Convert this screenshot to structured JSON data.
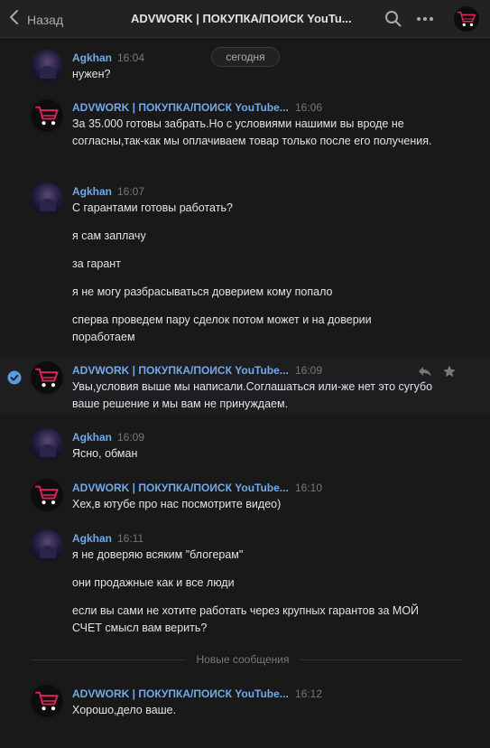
{
  "header": {
    "back_label": "Назад",
    "title": "ADVWORK | ПОКУПКА/ПОИСК YouTu..."
  },
  "date_label": "сегодня",
  "new_messages_label": "Новые сообщения",
  "messages": [
    {
      "author": "Agkhan",
      "time": "16:04",
      "lines": [
        "нужен?"
      ]
    },
    {
      "author": "ADVWORK | ПОКУПКА/ПОИСК YouTube...",
      "time": "16:06",
      "lines": [
        "За 35.000 готовы забрать.Но с условиями нашими вы вроде не согласны,так-как мы оплачиваем товар только после его получения."
      ]
    },
    {
      "author": "Agkhan",
      "time": "16:07",
      "lines": [
        "С гарантами готовы работать?",
        "я сам заплачу",
        "за гарант",
        "я не могу разбрасываться доверием кому попало",
        "сперва проведем пару сделок потом может и на доверии поработаем"
      ]
    },
    {
      "author": "ADVWORK | ПОКУПКА/ПОИСК YouTube...",
      "time": "16:09",
      "lines": [
        "Увы,условия выше мы написали.Соглашаться или-же нет это сугубо ваше решение и мы вам не принуждаем."
      ]
    },
    {
      "author": "Agkhan",
      "time": "16:09",
      "lines": [
        "Ясно, обман"
      ]
    },
    {
      "author": "ADVWORK | ПОКУПКА/ПОИСК YouTube...",
      "time": "16:10",
      "lines": [
        "Хех,в ютубе про нас посмотрите видео)"
      ]
    },
    {
      "author": "Agkhan",
      "time": "16:11",
      "lines": [
        "я не доверяю всяким \"блогерам\"",
        "они продажные как и все люди",
        "если вы сами не хотите работать через крупных гарантов за МОЙ СЧЕТ смысл вам верить?"
      ]
    },
    {
      "author": "ADVWORK | ПОКУПКА/ПОИСК YouTube...",
      "time": "16:12",
      "lines": [
        "Хорошо,дело ваше."
      ]
    }
  ],
  "icons": {
    "back": "chevron-left-icon",
    "search": "search-icon",
    "more": "more-icon",
    "reply": "reply-icon",
    "favorite": "star-icon",
    "read": "check-circle-icon",
    "cart": "shopping-cart-icon"
  },
  "colors": {
    "background": "#19191a",
    "header": "#222223",
    "author_link": "#71aaeb",
    "text": "#e1e3e6",
    "muted": "#76787a",
    "cart_accent": "#e6245a",
    "check": "#5b9ce0"
  }
}
